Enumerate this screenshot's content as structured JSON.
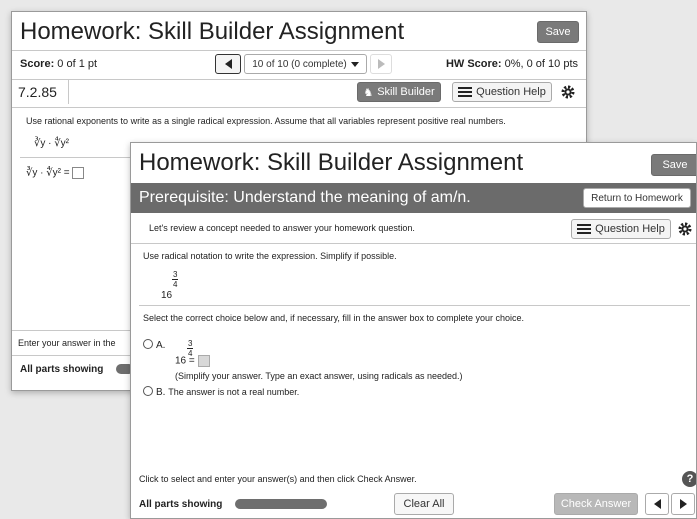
{
  "back": {
    "title": "Homework: Skill Builder Assignment",
    "save_label": "Save",
    "score_label": "Score:",
    "score_value": " 0 of 1 pt",
    "nav_position": "10 of 10 (0 complete)",
    "hw_score_label": "HW Score:",
    "hw_score_value": " 0%, 0 of 10 pts",
    "question_id": "7.2.85",
    "skill_builder_label": "Skill Builder",
    "question_help_label": "Question Help",
    "instruction": "Use rational exponents to write as a single radical expression. Assume that all variables represent positive real numbers.",
    "expr": "∛y · ∜y²",
    "expr_answer": "∛y · ∜y² =",
    "enter_answer": "Enter your answer in the",
    "all_parts": "All parts showing"
  },
  "front": {
    "title": "Homework: Skill Builder Assignment",
    "save_label": "Save",
    "prereq": "Prerequisite: Understand the meaning of am/n.",
    "return_label": "Return to Homework",
    "review_text": "Let's review a concept needed to answer your homework question.",
    "question_help_label": "Question Help",
    "instruction": "Use radical notation to write the expression. Simplify if possible.",
    "base": "16",
    "exp_num": "3",
    "exp_den": "4",
    "choice_prompt": "Select the correct choice below and, if necessary, fill in the answer box to complete your choice.",
    "choice_a_label": "A.",
    "choice_a_eq": "=",
    "choice_a_hint": "(Simplify your answer. Type an exact answer, using radicals as needed.)",
    "choice_b_label": "B.",
    "choice_b_text": "The answer is not a real number.",
    "footer_text": "Click to select and enter your answer(s) and then click Check Answer.",
    "help_glyph": "?",
    "all_parts": "All parts showing",
    "clear_all_label": "Clear All",
    "check_answer_label": "Check Answer"
  },
  "colors": {
    "header_band": "#6b6b6b",
    "dark_button": "#7a7a7a"
  }
}
